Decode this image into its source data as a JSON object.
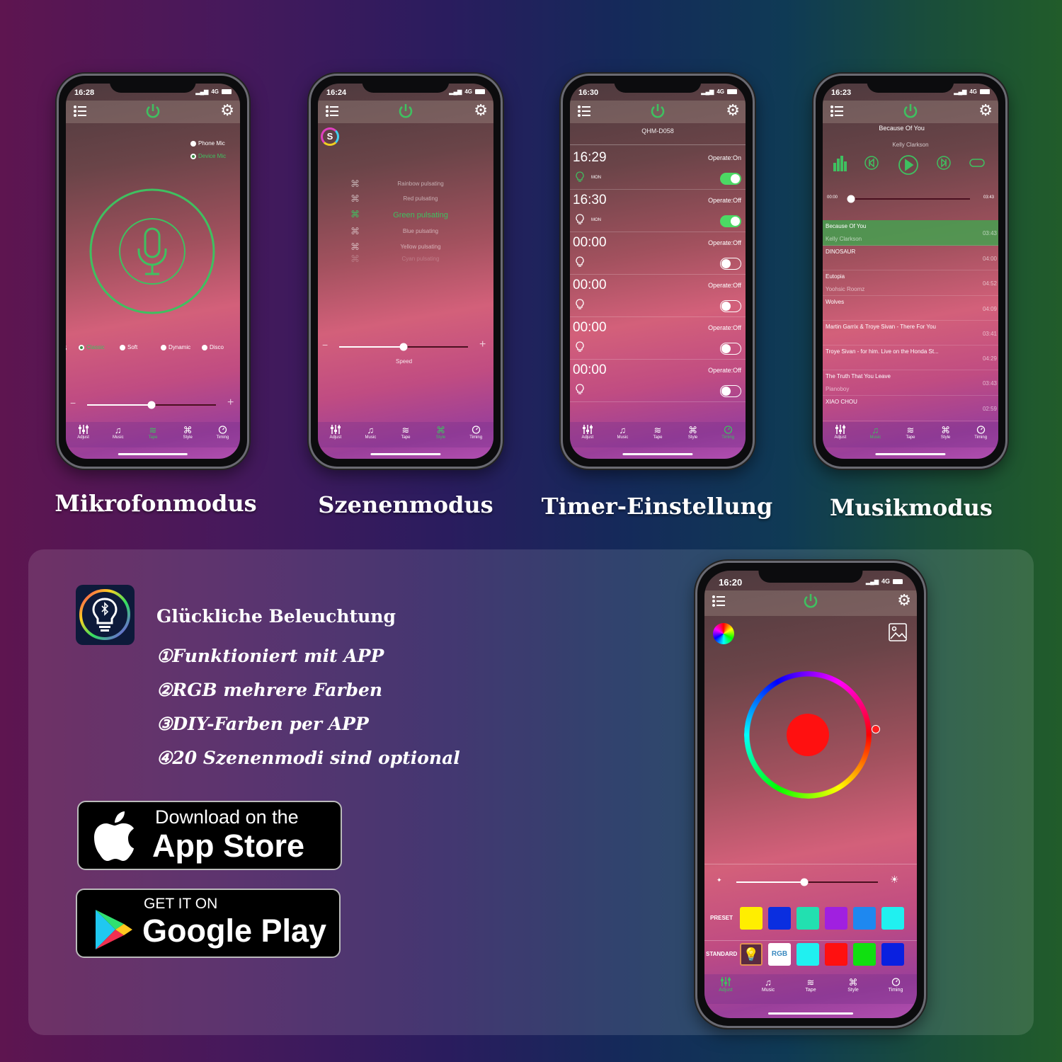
{
  "tab_labels": [
    "Adjust",
    "Music",
    "Tape",
    "Style",
    "Timing"
  ],
  "accent_color": "#3fc060",
  "phones": {
    "microphone": {
      "time": "16:28",
      "network": "4G",
      "active_tab": 2,
      "mic_options": [
        "Phone Mic",
        "Device Mic"
      ],
      "mic_selected": 1,
      "modes": [
        "S",
        "Classic",
        "Soft",
        "Dynamic",
        "Disco"
      ],
      "mode_selected": 1,
      "sensitivity_percent": 50,
      "minus": "−",
      "plus": "+"
    },
    "scene": {
      "time": "16:24",
      "network": "4G",
      "active_tab": 3,
      "badge": "S",
      "scenes": [
        "Rainbow pulsating",
        "Red pulsating",
        "Green pulsating",
        "Blue pulsating",
        "Yellow pulsating",
        "Cyan pulsating"
      ],
      "scene_selected": 2,
      "speed_label": "Speed",
      "speed_percent": 50,
      "minus": "−",
      "plus": "+"
    },
    "timer": {
      "time": "16:30",
      "network": "4G",
      "active_tab": 4,
      "device_name": "QHM-D058",
      "timers": [
        {
          "time": "16:29",
          "operate": "Operate:On",
          "day": "MON",
          "enabled": true
        },
        {
          "time": "16:30",
          "operate": "Operate:Off",
          "day": "MON",
          "enabled": true
        },
        {
          "time": "00:00",
          "operate": "Operate:Off",
          "day": "",
          "enabled": false
        },
        {
          "time": "00:00",
          "operate": "Operate:Off",
          "day": "",
          "enabled": false
        },
        {
          "time": "00:00",
          "operate": "Operate:Off",
          "day": "",
          "enabled": false
        },
        {
          "time": "00:00",
          "operate": "Operate:Off",
          "day": "",
          "enabled": false
        }
      ]
    },
    "music": {
      "time": "16:23",
      "network": "4G",
      "active_tab": 1,
      "now_playing_title": "Because Of You",
      "now_playing_artist": "Kelly Clarkson",
      "elapsed": "00:00",
      "duration": "03:43",
      "progress_percent": 0,
      "songs": [
        {
          "title": "Because Of You",
          "artist": "Kelly Clarkson",
          "duration": "03:43",
          "active": true
        },
        {
          "title": "DINOSAUR",
          "artist": "",
          "duration": "04:00"
        },
        {
          "title": "Eutopia",
          "artist": "Yoohsic Roomz",
          "duration": "04:52"
        },
        {
          "title": "Wolves",
          "artist": "",
          "duration": "04:09"
        },
        {
          "title": "Martin Garrix & Troye Sivan - There For You",
          "artist": "",
          "duration": "03:41"
        },
        {
          "title": "Troye Sivan - for him. Live on the Honda St...",
          "artist": "",
          "duration": "04:29"
        },
        {
          "title": "The Truth That You Leave",
          "artist": "Pianoboy",
          "duration": "03:43"
        },
        {
          "title": "XIAO CHOU",
          "artist": "",
          "duration": "02:59"
        }
      ]
    },
    "adjust": {
      "time": "16:20",
      "network": "4G",
      "active_tab": 0,
      "selected_color": "#ff1010",
      "brightness_percent": 48,
      "preset_label": "PRESET",
      "standard_label": "STANDARD",
      "rgb_label": "RGB",
      "preset_colors": [
        "#ffee00",
        "#0a2ee0",
        "#22e0b0",
        "#a020e0",
        "#1e88f0",
        "#20f0f0"
      ],
      "standard_colors": [
        "#20f0f0",
        "#ff1010",
        "#10e010",
        "#0a20e0"
      ]
    }
  },
  "mode_labels": [
    "Mikrofonmodus",
    "Szenenmodus",
    "Timer-Einstellung",
    "Musikmodus"
  ],
  "features": {
    "title": "Glückliche Beleuchtung",
    "items": [
      "①Funktioniert mit APP",
      "②RGB mehrere Farben",
      "③DIY-Farben per APP",
      "④20 Szenenmodi sind optional"
    ]
  },
  "app_store": {
    "line1": "Download on the",
    "line2": "App Store"
  },
  "google_play": {
    "line1": "GET IT ON",
    "line2": "Google Play"
  }
}
